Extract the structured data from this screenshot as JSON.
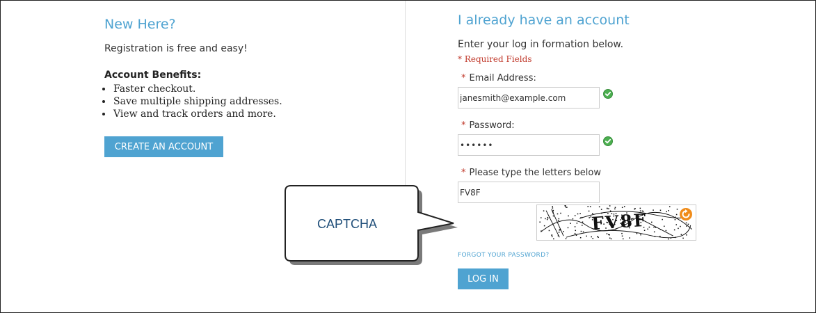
{
  "colors": {
    "accent": "#4fa3d1",
    "button_bg": "#4fa3d1",
    "button_text": "#ffffff",
    "required": "#c0392b",
    "valid": "#4caf50",
    "callout_text": "#1f4e79"
  },
  "register": {
    "title": "New Here?",
    "intro": "Registration is free and easy!",
    "benefits_title": "Account Benefits:",
    "benefits": [
      "Faster checkout.",
      "Save multiple shipping addresses.",
      "View and track orders and more."
    ],
    "create_button": "CREATE AN ACCOUNT"
  },
  "login": {
    "title": "I already have an account",
    "intro": "Enter your log in formation below.",
    "required_note": "* Required Fields",
    "required_star": "*",
    "email_label": "Email Address:",
    "email_value": "janesmith@example.com",
    "email_icon": "check-circle-icon",
    "password_label": "Password:",
    "password_value": "••••••",
    "password_icon": "check-circle-icon",
    "captcha_label": "Please type the letters below",
    "captcha_value": "FV8F",
    "captcha_image_text": "FV8F",
    "captcha_refresh_icon": "refresh-icon",
    "forgot_link": "FORGOT YOUR PASSWORD?",
    "login_button": "LOG IN"
  },
  "callout": {
    "text": "CAPTCHA"
  }
}
